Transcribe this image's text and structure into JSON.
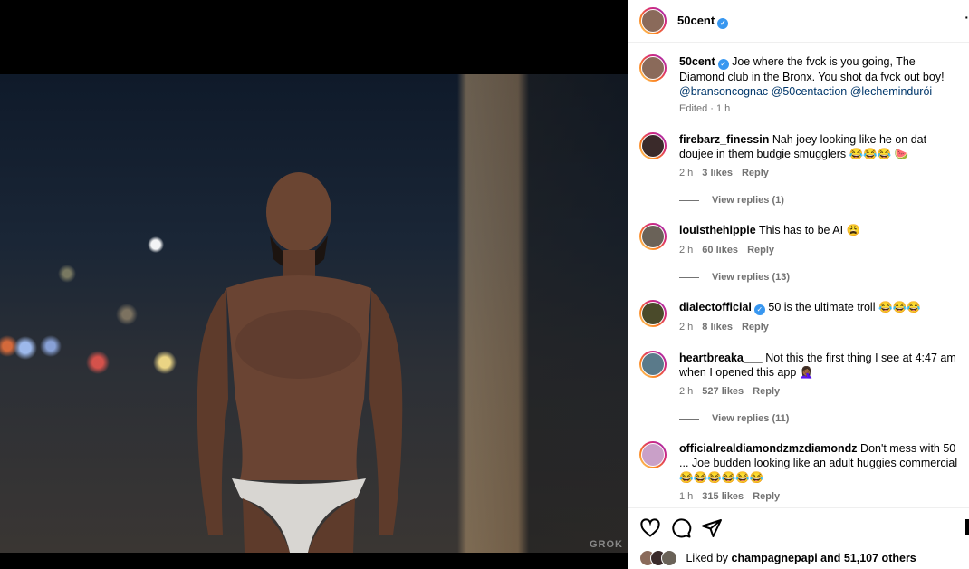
{
  "media": {
    "watermark": "GROK"
  },
  "post": {
    "author": "50cent",
    "caption": {
      "author": "50cent",
      "text": "Joe where the fvck is you going, The Diamond club in the Bronx. You shot da fvck out boy!",
      "mentions": "@bransoncognac @50centaction @lechemindurói",
      "meta": "Edited · 1 h"
    },
    "comments": [
      {
        "user": "firebarz_finessin",
        "text": "Nah joey looking like he on dat doujee in them budgie smugglers 😂😂😂 🍉",
        "time": "2 h",
        "likes": "3 likes",
        "reply": "Reply",
        "replies": "View replies (1)"
      },
      {
        "user": "louisthehippie",
        "text": "This has to be AI 😩",
        "time": "2 h",
        "likes": "60 likes",
        "reply": "Reply",
        "replies": "View replies (13)"
      },
      {
        "user": "dialectofficial",
        "text": "50 is the ultimate troll 😂😂😂",
        "time": "2 h",
        "likes": "8 likes",
        "reply": "Reply"
      },
      {
        "user": "heartbreaka___",
        "text": "Not this the first thing I see at 4:47 am when I opened this app 🤦🏾‍♀️",
        "time": "2 h",
        "likes": "527 likes",
        "reply": "Reply",
        "replies": "View replies (11)"
      },
      {
        "user": "officialrealdiamondzmzdiamondz",
        "text": "Don't mess with 50 ... Joe budden looking like an adult huggies commercial 😂😂😂😂😂😂",
        "time": "1 h",
        "likes": "315 likes",
        "reply": "Reply"
      }
    ],
    "liked_by_prefix": "Liked by ",
    "liked_by_user": "champagnepapi",
    "liked_by_suffix": " and 51,107 others"
  },
  "icons": [
    "heart-icon",
    "comment-icon",
    "share-icon",
    "bookmark-icon",
    "more-icon",
    "verified-badge-icon"
  ],
  "colors": {
    "verified": "#3897f0",
    "mention": "#00376b",
    "meta": "#737373"
  }
}
